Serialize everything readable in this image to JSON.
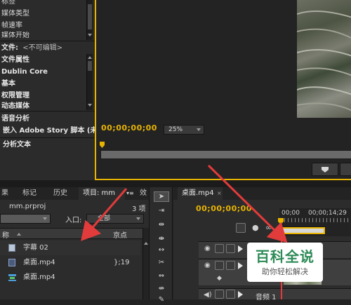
{
  "metadata_panel": {
    "list_items": [
      "标签",
      "媒体类型",
      "帧速率",
      "媒体开始"
    ],
    "file_label": "文件:",
    "file_value": "<不可编辑>",
    "sections": [
      "文件属性",
      "Dublin Core",
      "基本",
      "权限管理",
      "动态媒体"
    ],
    "speech_analysis": "语音分析",
    "embed_script": "嵌入 Adobe Story 脚本 (未",
    "analyze_text": "分析文本"
  },
  "source_monitor": {
    "timecode": "00;00;00;00",
    "zoom": "25%",
    "colors": {
      "timecode": "#e8b400",
      "playhead": "#e8b400"
    }
  },
  "project_panel": {
    "tabs": [
      "果",
      "标记",
      "历史",
      "项目: mm",
      "效"
    ],
    "project_file": "mm.prproj",
    "item_count": "3 项",
    "entry_label": "入口:",
    "entry_value": "全部",
    "col_name": "称",
    "col_inpoint": "京点",
    "items": [
      {
        "icon": "title-icon",
        "name": "字幕 02",
        "duration": ""
      },
      {
        "icon": "video-clip-icon",
        "name": "桌面.mp4",
        "duration": "};19"
      },
      {
        "icon": "sequence-icon",
        "name": "桌面.mp4",
        "duration": ""
      }
    ]
  },
  "timeline": {
    "tab": "桌面.mp4",
    "timecode": "00;00;00;00",
    "ruler_labels": [
      "00;00",
      "00;00;14;29"
    ],
    "audio_track": "音频 1"
  },
  "watermark": {
    "title": "百科全说",
    "subtitle": "助你轻松解决"
  },
  "colors": {
    "accent": "#e8b400",
    "arrow": "#e23b3b",
    "playhead": "#e23b3b"
  }
}
